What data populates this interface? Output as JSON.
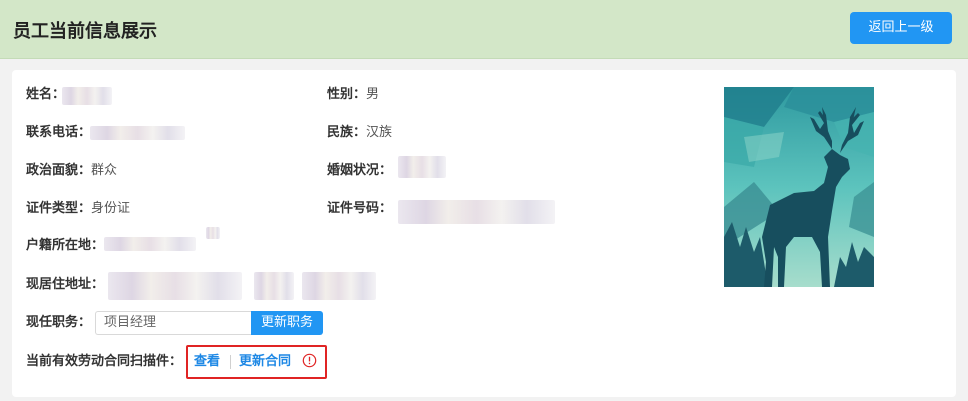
{
  "header": {
    "title": "员工当前信息展示",
    "back_label": "返回上一级",
    "bg_color": "#d3e7c8",
    "accent_color": "#2196f3"
  },
  "fields": {
    "name_label": "姓名：",
    "gender_label": "性别：",
    "gender_value": "男",
    "phone_label": "联系电话：",
    "ethnicity_label": "民族：",
    "ethnicity_value": "汉族",
    "political_label": "政治面貌：",
    "political_value": "群众",
    "marital_label": "婚姻状况：",
    "id_type_label": "证件类型：",
    "id_type_value": "身份证",
    "id_number_label": "证件号码：",
    "hukou_label": "户籍所在地：",
    "address_label": "现居住地址：",
    "duty_label": "现任职务："
  },
  "duty": {
    "value": "项目经理",
    "update_label": "更新职务"
  },
  "contract": {
    "label": "当前有效劳动合同扫描件：",
    "view_label": "查看",
    "update_label": "更新合同",
    "highlight_color": "#e02424",
    "warning_icon": "exclamation-circle-icon"
  },
  "photo": {
    "icon": "deer-silhouette-image"
  }
}
